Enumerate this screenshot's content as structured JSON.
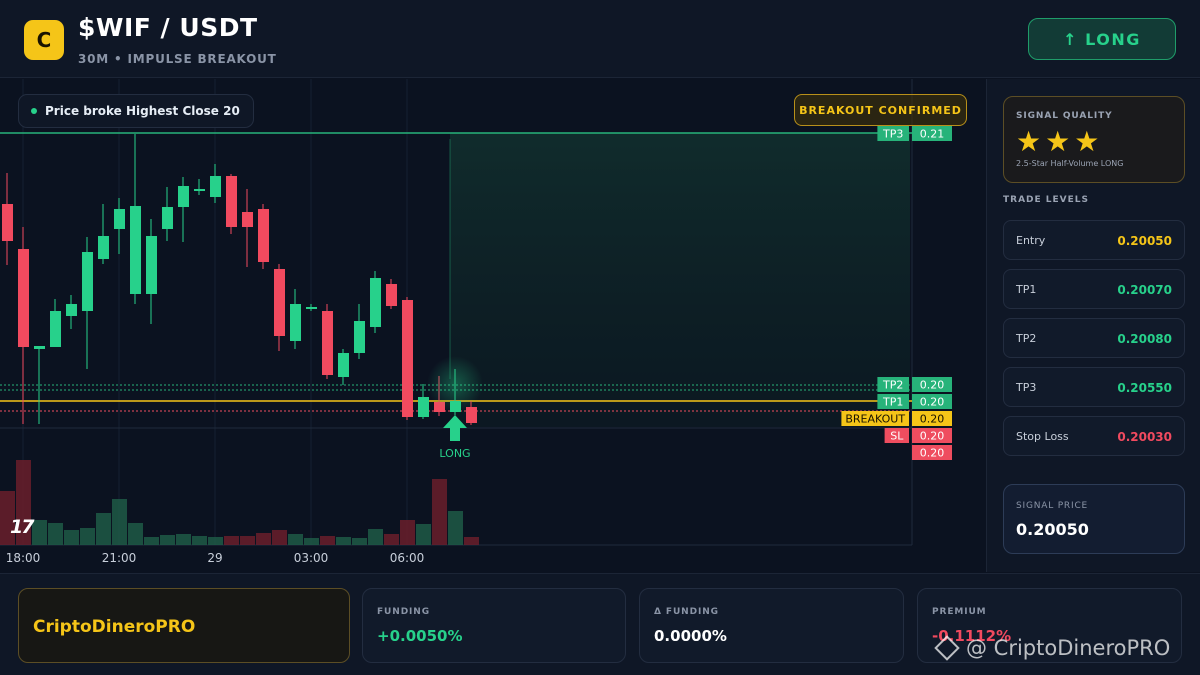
{
  "header": {
    "logo_letter": "C",
    "pair": "$WIF / USDT",
    "subtitle": "30M • IMPULSE BREAKOUT",
    "long_button": "↑ LONG"
  },
  "chart": {
    "price_pill": "Price broke Highest Close 20",
    "confirm_badge": "BREAKOUT CONFIRMED",
    "tv_logo": "17",
    "long_marker_label": "LONG",
    "time_labels": [
      "18:00",
      "21:00",
      "29",
      "03:00",
      "06:00"
    ],
    "line_tags": [
      {
        "label": "TP3",
        "value": "0.21",
        "color": "#27b37a"
      },
      {
        "label": "TP2",
        "value": "0.20",
        "color": "#27b37a"
      },
      {
        "label": "TP1",
        "value": "0.20",
        "color": "#27b37a"
      },
      {
        "label": "BREAKOUT",
        "value": "0.20",
        "color": "#f5c518"
      },
      {
        "label": "SL",
        "value": "0.20",
        "color": "#ef4d5f"
      },
      {
        "label": "",
        "value": "0.20",
        "color": "#ef4d5f"
      }
    ],
    "colors": {
      "up": "#27d18b",
      "down": "#f14a5f",
      "tp": "#27b37a",
      "breakout": "#f5c518",
      "sl": "#ef4d5f"
    }
  },
  "side": {
    "signal_quality_label": "SIGNAL QUALITY",
    "stars": "★★★",
    "quality_desc": "2.5-Star Half-Volume LONG",
    "trade_levels_title": "TRADE LEVELS",
    "levels": [
      {
        "name": "Entry",
        "value": "0.20050",
        "color": "#f5c518"
      },
      {
        "name": "TP1",
        "value": "0.20070",
        "color": "#27d18b"
      },
      {
        "name": "TP2",
        "value": "0.20080",
        "color": "#27d18b"
      },
      {
        "name": "TP3",
        "value": "0.20550",
        "color": "#27d18b"
      },
      {
        "name": "Stop Loss",
        "value": "0.20030",
        "color": "#f14a5f"
      }
    ],
    "signal_price_label": "SIGNAL PRICE",
    "signal_price": "0.20050"
  },
  "footer": {
    "brand": "CriptoDineroPRO",
    "funding_label": "FUNDING",
    "funding_value": "+0.0050%",
    "delta_funding_label": "Δ FUNDING",
    "delta_funding_value": "0.0000%",
    "premium_label": "PREMIUM",
    "premium_value": "-0.1112%",
    "watermark": "@ CriptoDineroPRO"
  }
}
